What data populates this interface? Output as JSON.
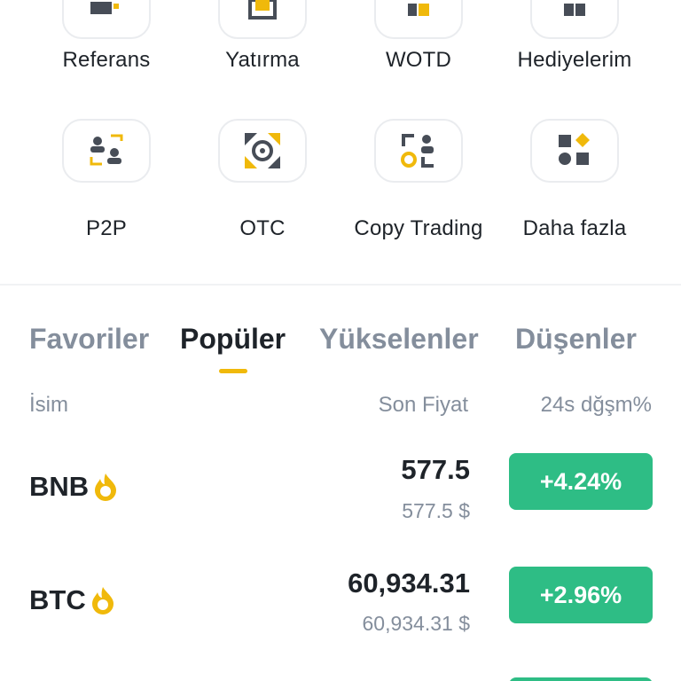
{
  "shortcuts_row1": [
    {
      "label": "Referans",
      "icon": "referral-icon"
    },
    {
      "label": "Yatırma",
      "icon": "deposit-icon"
    },
    {
      "label": "WOTD",
      "icon": "wotd-icon"
    },
    {
      "label": "Hediyelerim",
      "icon": "gift-icon"
    }
  ],
  "shortcuts_row2": [
    {
      "label": "P2P",
      "icon": "p2p-icon"
    },
    {
      "label": "OTC",
      "icon": "otc-icon"
    },
    {
      "label": "Copy Trading",
      "icon": "copy-trading-icon"
    },
    {
      "label": "Daha fazla",
      "icon": "more-icon"
    }
  ],
  "tabs": [
    {
      "label": "Favoriler",
      "active": false
    },
    {
      "label": "Popüler",
      "active": true
    },
    {
      "label": "Yükselenler",
      "active": false
    },
    {
      "label": "Düşenler",
      "active": false
    }
  ],
  "columns": {
    "name": "İsim",
    "last_price": "Son Fiyat",
    "change": "24s dğşm%"
  },
  "markets": [
    {
      "symbol": "BNB",
      "price": "577.5",
      "price_usd": "577.5 $",
      "change": "+4.24%"
    },
    {
      "symbol": "BTC",
      "price": "60,934.31",
      "price_usd": "60,934.31 $",
      "change": "+2.96%"
    }
  ],
  "colors": {
    "accent": "#f0b90b",
    "positive": "#2ebd85",
    "text_primary": "#1e2329",
    "text_secondary": "#848e9c"
  }
}
